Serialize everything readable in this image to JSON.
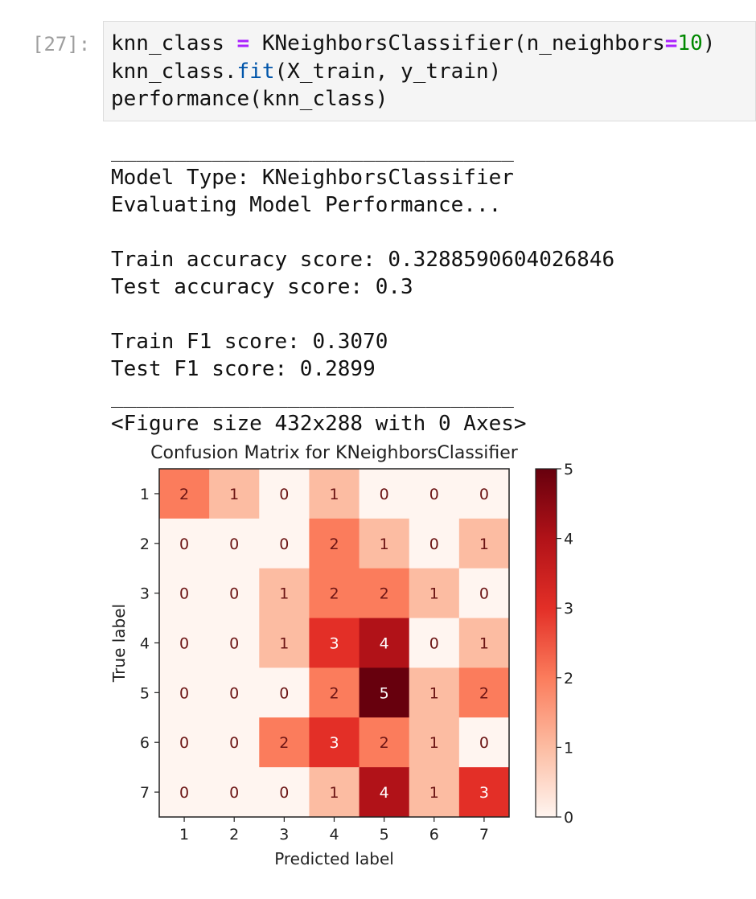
{
  "cell": {
    "prompt": "[27]:",
    "code": {
      "line1": {
        "var": "knn_class",
        "eq": "=",
        "call": "KNeighborsClassifier(n_neighbors",
        "eq2": "=",
        "num": "10",
        "close": ")"
      },
      "line2": {
        "pre": "knn_class.",
        "fn": "fit",
        "post": "(X_train, y_train)"
      },
      "line3": "performance(knn_class)"
    }
  },
  "output": {
    "rule": "________________________________",
    "model_type": "Model Type: KNeighborsClassifier",
    "evaluating": "Evaluating Model Performance...",
    "train_acc": "Train accuracy score: 0.3288590604026846",
    "test_acc": "Test accuracy score: 0.3",
    "train_f1": "Train F1 score: 0.3070",
    "test_f1": "Test F1 score: 0.2899",
    "figure_repr": "<Figure size 432x288 with 0 Axes>"
  },
  "chart_data": {
    "type": "heatmap",
    "title": "Confusion Matrix for KNeighborsClassifier",
    "xlabel": "Predicted label",
    "ylabel": "True label",
    "x_labels": [
      "1",
      "2",
      "3",
      "4",
      "5",
      "6",
      "7"
    ],
    "y_labels": [
      "1",
      "2",
      "3",
      "4",
      "5",
      "6",
      "7"
    ],
    "matrix": [
      [
        2,
        1,
        0,
        1,
        0,
        0,
        0
      ],
      [
        0,
        0,
        0,
        2,
        1,
        0,
        1
      ],
      [
        0,
        0,
        1,
        2,
        2,
        1,
        0
      ],
      [
        0,
        0,
        1,
        3,
        4,
        0,
        1
      ],
      [
        0,
        0,
        0,
        2,
        5,
        1,
        2
      ],
      [
        0,
        0,
        2,
        3,
        2,
        1,
        0
      ],
      [
        0,
        0,
        0,
        1,
        4,
        1,
        3
      ]
    ],
    "colormap": "Reds",
    "colorbar_ticks": [
      "0",
      "1",
      "2",
      "3",
      "4",
      "5"
    ],
    "vmin": 0,
    "vmax": 5,
    "colors": {
      "0": "#fff5f0",
      "1": "#fcbca2",
      "2": "#fb7c5c",
      "3": "#e32f27",
      "4": "#b11218",
      "5": "#67000d"
    }
  }
}
